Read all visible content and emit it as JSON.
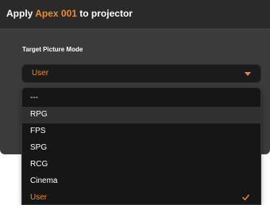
{
  "dialog": {
    "title_prefix": "Apply ",
    "title_highlight": "Apex 001",
    "title_suffix": " to projector"
  },
  "field": {
    "label": "Target Picture Mode",
    "selected_value": "User"
  },
  "dropdown": {
    "options": [
      {
        "label": "---"
      },
      {
        "label": "RPG"
      },
      {
        "label": "FPS"
      },
      {
        "label": "SPG"
      },
      {
        "label": "RCG"
      },
      {
        "label": "Cinema"
      },
      {
        "label": "User"
      }
    ],
    "highlighted_option": "RPG",
    "selected_option": "User"
  },
  "colors": {
    "accent": "#f08a2c",
    "dialog_background": "#3b3b3b",
    "header_background": "#2a2a2a",
    "dropdown_background": "#161616",
    "highlight_background": "#303030"
  },
  "icons": {
    "select_arrow": "chevron-down-icon",
    "selected_mark": "check-icon"
  }
}
